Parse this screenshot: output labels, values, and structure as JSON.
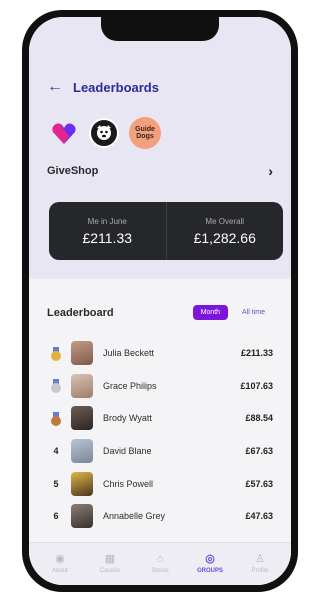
{
  "header": {
    "back_icon": "arrow-left-icon",
    "title": "Leaderboards"
  },
  "charities": [
    {
      "name": "givestar-logo",
      "color": "#6d2cf0"
    },
    {
      "name": "charity-dark-logo",
      "color": "#1a1a1a"
    },
    {
      "name": "guide-dogs-logo",
      "text": "Guide Dogs",
      "color": "#f2a07e"
    }
  ],
  "shop": {
    "name": "GiveShop",
    "chevron": "›"
  },
  "stats": [
    {
      "label": "Me in June",
      "value": "£211.33"
    },
    {
      "label": "Me Overall",
      "value": "£1,282.66"
    }
  ],
  "leaderboard": {
    "title": "Leaderboard",
    "toggle": {
      "month": "Month",
      "alltime": "All time",
      "active": "month"
    },
    "rows": [
      {
        "rank": "1",
        "medal": "gold",
        "name": "Julia Beckett",
        "amount": "£211.33"
      },
      {
        "rank": "2",
        "medal": "silver",
        "name": "Grace Philips",
        "amount": "£107.63"
      },
      {
        "rank": "3",
        "medal": "bronze",
        "name": "Brody Wyatt",
        "amount": "£88.54"
      },
      {
        "rank": "4",
        "medal": "",
        "name": "David Blane",
        "amount": "£67.63"
      },
      {
        "rank": "5",
        "medal": "",
        "name": "Chris Powell",
        "amount": "£57.63"
      },
      {
        "rank": "6",
        "medal": "",
        "name": "Annabelle Grey",
        "amount": "£47.63"
      }
    ]
  },
  "nav": [
    {
      "label": "About",
      "icon": "info-icon"
    },
    {
      "label": "Causes",
      "icon": "causes-icon"
    },
    {
      "label": "Stores",
      "icon": "home-icon"
    },
    {
      "label": "GROUPS",
      "icon": "groups-icon",
      "active": true
    },
    {
      "label": "Profile",
      "icon": "profile-icon"
    }
  ],
  "colors": {
    "accent": "#7c16d8",
    "title": "#2e2a9c",
    "card": "#26272b",
    "gold": "#e2b23a",
    "silver": "#c7c7cc",
    "bronze": "#c07a3a"
  }
}
